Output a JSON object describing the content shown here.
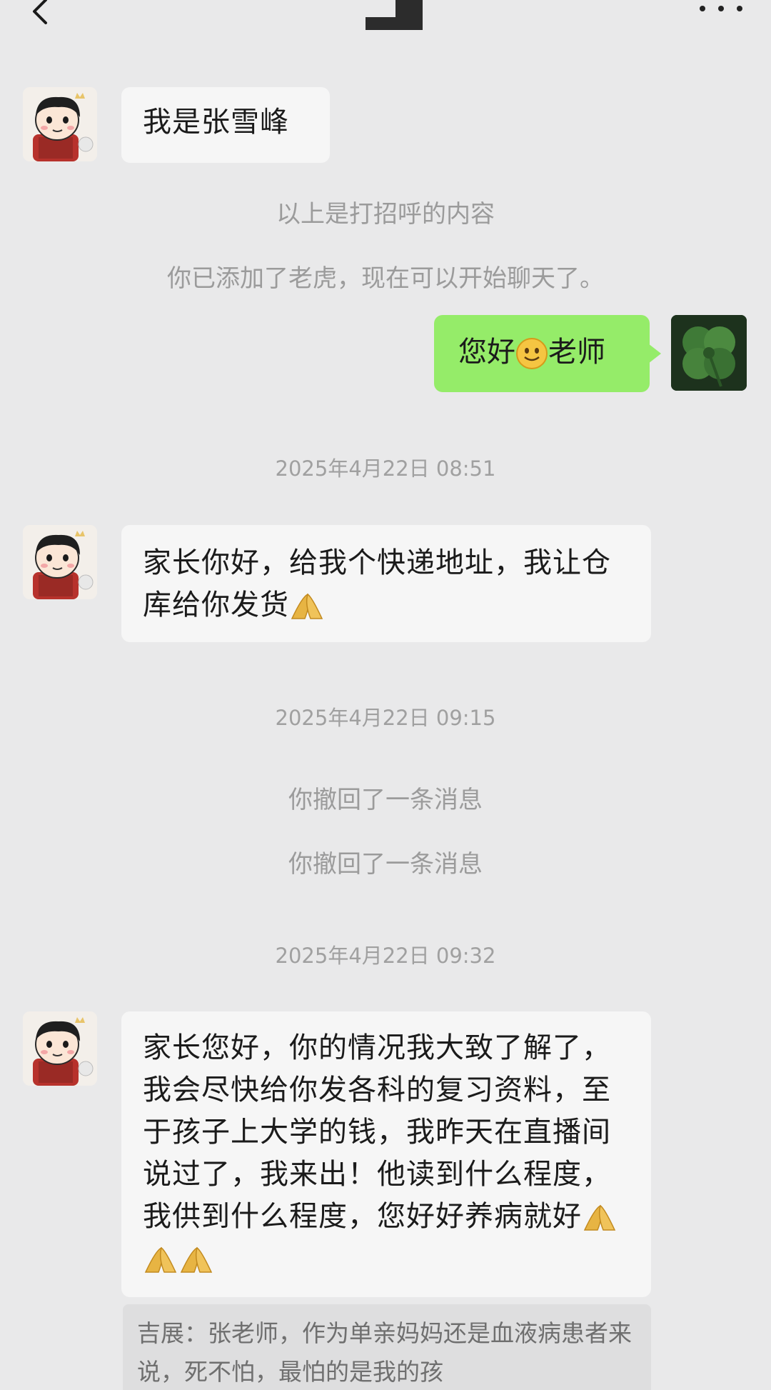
{
  "messages": {
    "m1": "我是张雪峰",
    "sys1": "以上是打招呼的内容",
    "sys2": "你已添加了老虎，现在可以开始聊天了。",
    "mine_before": "您好",
    "mine_after": "老师",
    "time1": "2025年4月22日 08:51",
    "m2": "家长你好，给我个快递地址，我让仓库给你发货",
    "time2": "2025年4月22日 09:15",
    "recall1": "你撤回了一条消息",
    "recall2": "你撤回了一条消息",
    "time3": "2025年4月22日 09:32",
    "m3": "家长您好，你的情况我大致了解了，我会尽快给你发各科的复习资料，至于孩子上大学的钱，我昨天在直播间说过了，我来出！他读到什么程度，我供到什么程度，您好好养病就好",
    "quote": "吉展：张老师，作为单亲妈妈还是血液病患者来说，死不怕，最怕的是我的孩"
  },
  "colors": {
    "background": "#e9e9ea",
    "incoming_bubble": "#f6f6f6",
    "outgoing_bubble": "#95ec69"
  },
  "icons": {
    "back": "chevron-left-icon",
    "more": "more-dots-icon",
    "smile": "smile-emoji-icon",
    "praying_hands": "praying-hands-icon",
    "clover": "four-leaf-clover-avatar"
  }
}
